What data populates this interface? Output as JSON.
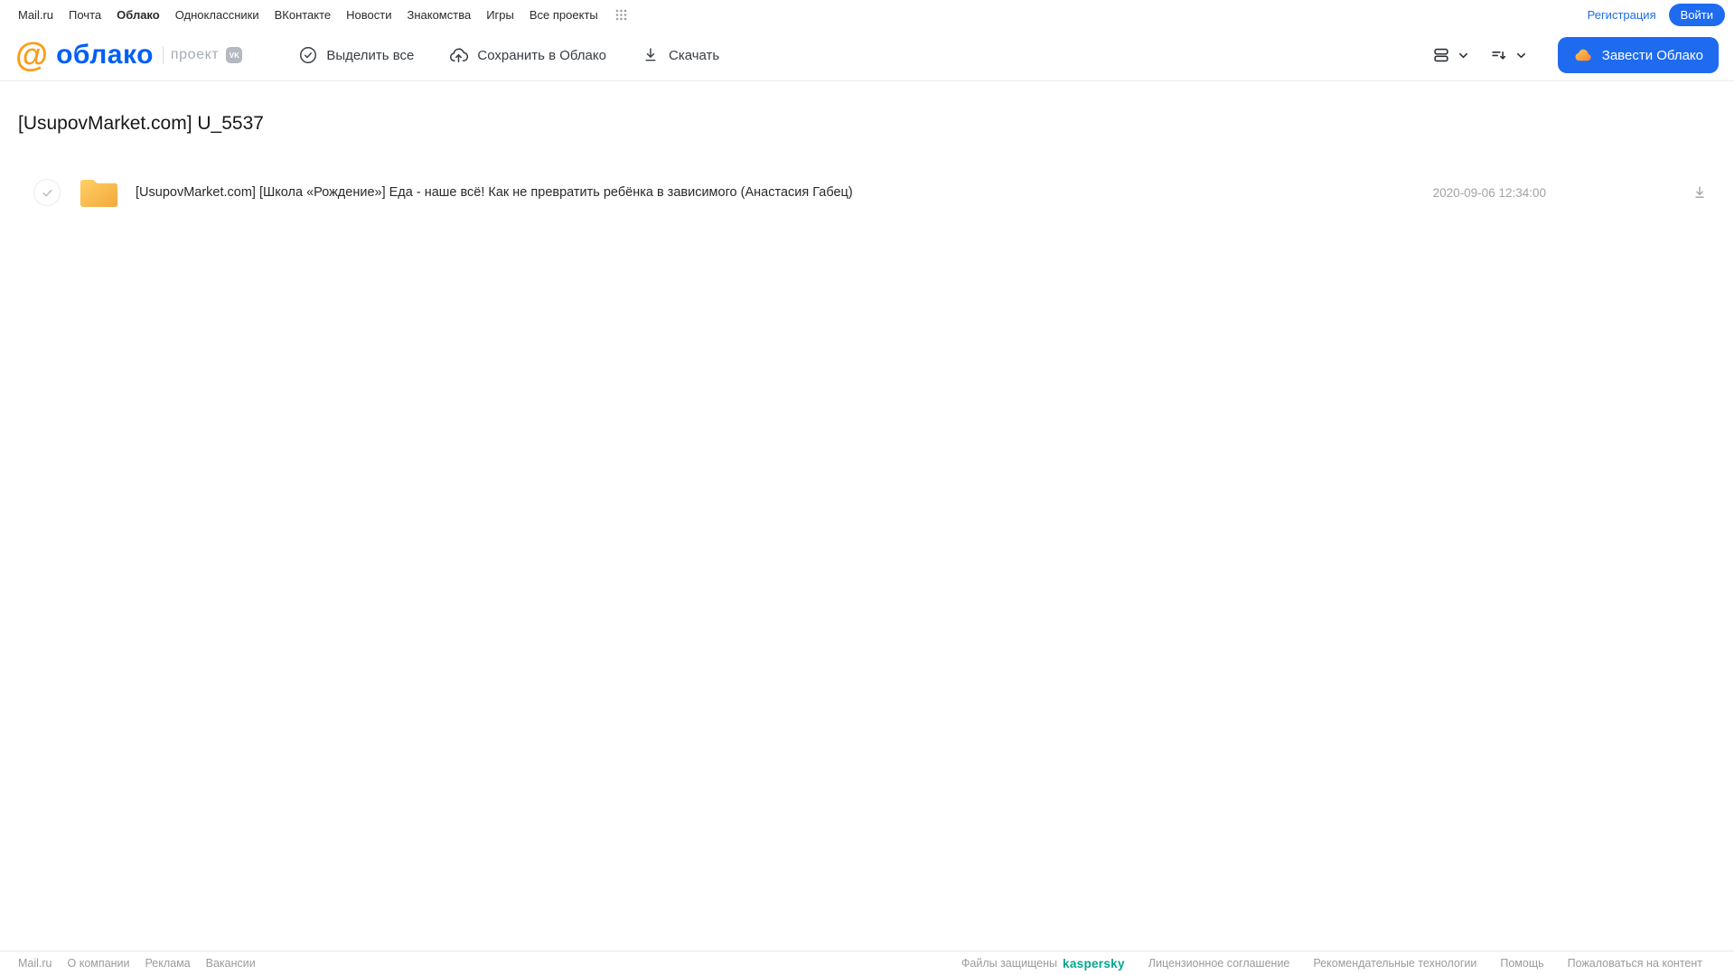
{
  "topnav": {
    "links": [
      {
        "label": "Mail.ru"
      },
      {
        "label": "Почта"
      },
      {
        "label": "Облако"
      },
      {
        "label": "Одноклассники"
      },
      {
        "label": "ВКонтакте"
      },
      {
        "label": "Новости"
      },
      {
        "label": "Знакомства"
      },
      {
        "label": "Игры"
      },
      {
        "label": "Все проекты"
      }
    ],
    "register_label": "Регистрация",
    "login_label": "Войти"
  },
  "header": {
    "logo_at": "@",
    "logo_word": "облако",
    "project_label": "проект",
    "vk_badge": "VK",
    "toolbar": [
      {
        "label": "Выделить все"
      },
      {
        "label": "Сохранить в Облако"
      },
      {
        "label": "Скачать"
      }
    ],
    "cta_label": "Завести Облако"
  },
  "main": {
    "title": "[UsupovMarket.com] U_5537",
    "files": [
      {
        "type": "folder",
        "name": "[UsupovMarket.com] [Школа «Рождение»] Еда - наше всё! Как не превратить ребёнка в зависимого (Анастасия Габец)",
        "date": "2020-09-06 12:34:00"
      }
    ]
  },
  "footer": {
    "left_links": [
      "Mail.ru",
      "О компании",
      "Реклама",
      "Вакансии"
    ],
    "protected_label": "Файлы защищены",
    "kaspersky_label": "kaspersky",
    "right_links": [
      "Лицензионное соглашение",
      "Рекомендательные технологии",
      "Помощь",
      "Пожаловаться на контент"
    ]
  },
  "colors": {
    "brand_blue": "#005ff9",
    "button_blue": "#1e6bf0",
    "logo_orange": "#fb9d17",
    "folder_yellow": "#f6b345",
    "kaspersky_green": "#00a88e"
  }
}
